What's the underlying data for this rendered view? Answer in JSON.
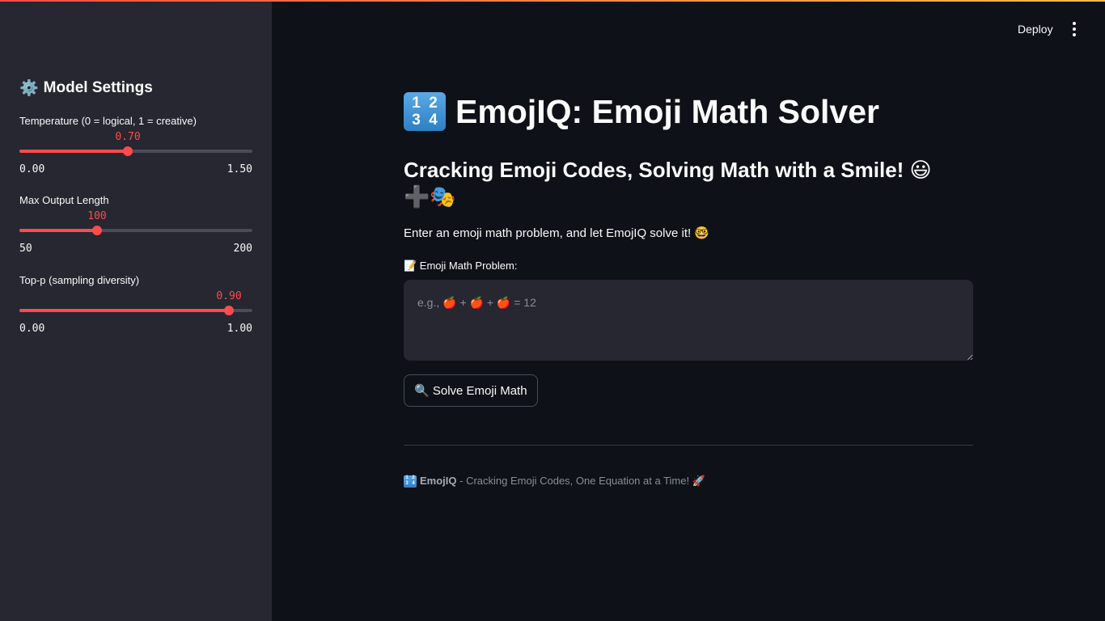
{
  "header": {
    "deploy_label": "Deploy",
    "menu_icon": "more-vertical-icon"
  },
  "sidebar": {
    "title": "Model Settings",
    "title_icon": "gear-icon",
    "sliders": [
      {
        "label": "Temperature (0 = logical, 1 = creative)",
        "value": "0.70",
        "min": "0.00",
        "max": "1.50",
        "fraction": 0.467
      },
      {
        "label": "Max Output Length",
        "value": "100",
        "min": "50",
        "max": "200",
        "fraction": 0.333
      },
      {
        "label": "Top-p (sampling diversity)",
        "value": "0.90",
        "min": "0.00",
        "max": "1.00",
        "fraction": 0.9
      }
    ]
  },
  "main": {
    "title": "EmojIQ: Emoji Math Solver",
    "title_icon": "numbers-1234-icon",
    "subtitle": "Cracking Emoji Codes, Solving Math with a Smile! 😃➕🎭",
    "intro": "Enter an emoji math problem, and let EmojIQ solve it! 🤓",
    "field_label": "📝 Emoji Math Problem:",
    "field_placeholder": "e.g., 🍎 + 🍎 + 🍎 = 12",
    "field_value": "",
    "solve_button": "🔍 Solve Emoji Math",
    "footer_brand": "EmojIQ",
    "footer_text": " - Cracking Emoji Codes, One Equation at a Time! 🚀"
  },
  "colors": {
    "accent": "#ff4b4b",
    "background": "#0e1117",
    "sidebar": "#262730"
  }
}
